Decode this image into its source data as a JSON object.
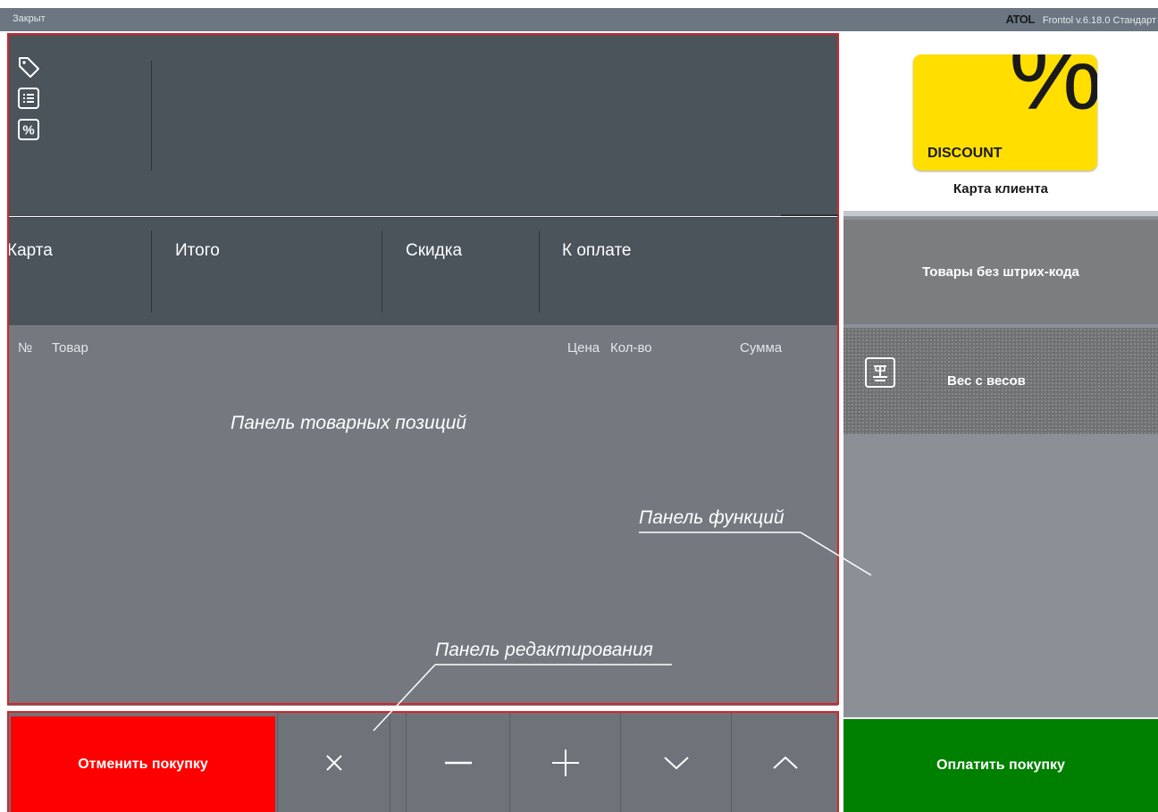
{
  "titlebar": {
    "status": "Закрыт",
    "logo": "ATOL",
    "version": "Frontol v.6.18.0 Стандарт"
  },
  "info_panel": {
    "icons": [
      "tag-icon",
      "receipt-list-icon",
      "percent-icon"
    ]
  },
  "totals": {
    "card": "Карта",
    "total": "Итого",
    "discount": "Скидка",
    "to_pay": "К оплате"
  },
  "items_table": {
    "headers": {
      "number": "№",
      "product": "Товар",
      "price": "Цена",
      "qty": "Кол-во",
      "sum": "Сумма"
    },
    "rows": []
  },
  "annotations": {
    "items_panel": "Панель товарных позиций",
    "functions_panel": "Панель функций",
    "edit_panel": "Панель редактирования"
  },
  "bottom_bar": {
    "cancel": "Отменить покупку",
    "controls": [
      "close-icon",
      "minus-icon",
      "plus-icon",
      "chevron-down-icon",
      "chevron-up-icon"
    ]
  },
  "functions": {
    "discount_card_text": "DISCOUNT",
    "discount_card_symbol": "%",
    "client_card": "Карта клиента",
    "no_barcode": "Товары без штрих-кода",
    "scale_weight": "Вес с весов",
    "pay": "Оплатить покупку"
  },
  "colors": {
    "cancel": "#ff0000",
    "pay": "#008000",
    "discount_card": "#ffde00",
    "highlight_frame": "#d8232a"
  }
}
